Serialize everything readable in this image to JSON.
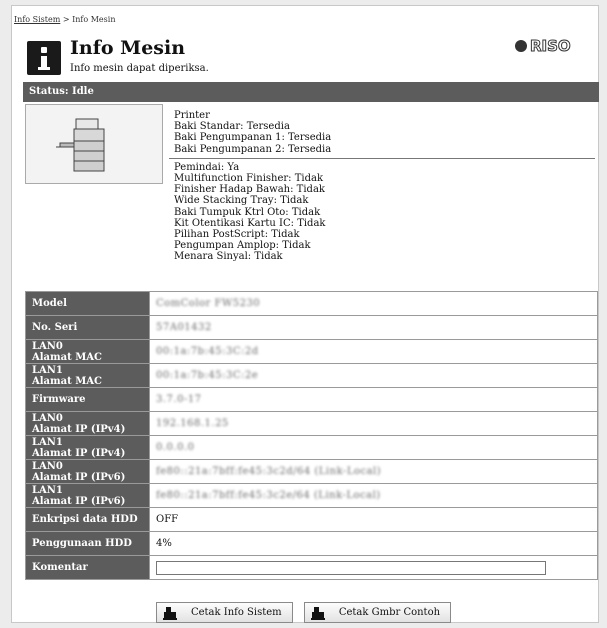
{
  "breadcrumb": {
    "link": "Info Sistem",
    "separator": ">",
    "current": "Info Mesin"
  },
  "header": {
    "title": "Info Mesin",
    "subtitle": "Info mesin dapat diperiksa.",
    "logo_text": "RISO"
  },
  "status": {
    "label": "Status: Idle"
  },
  "specs": {
    "group1": [
      "Printer",
      "Baki Standar: Tersedia",
      "Baki Pengumpanan 1: Tersedia",
      "Baki Pengumpanan 2: Tersedia"
    ],
    "group2": [
      "Pemindai: Ya",
      "Multifunction Finisher: Tidak",
      "Finisher Hadap Bawah: Tidak",
      "Wide Stacking Tray: Tidak",
      "Baki Tumpuk Ktrl Oto: Tidak",
      "Kit Otentikasi Kartu IC: Tidak",
      "Pilihan PostScript: Tidak",
      "Pengumpan Amplop: Tidak",
      "Menara Sinyal: Tidak"
    ]
  },
  "table": [
    {
      "label": [
        "Model"
      ],
      "value": "ComColor FW5230",
      "blurred": true
    },
    {
      "label": [
        "No. Seri"
      ],
      "value": "57A01432",
      "blurred": true
    },
    {
      "label": [
        "LAN0",
        "Alamat MAC"
      ],
      "value": "00:1a:7b:45:3C:2d",
      "blurred": true
    },
    {
      "label": [
        "LAN1",
        "Alamat MAC"
      ],
      "value": "00:1a:7b:45:3C:2e",
      "blurred": true
    },
    {
      "label": [
        "Firmware"
      ],
      "value": "3.7.0-17",
      "blurred": true
    },
    {
      "label": [
        "LAN0",
        "Alamat IP (IPv4)"
      ],
      "value": "192.168.1.25",
      "blurred": true
    },
    {
      "label": [
        "LAN1",
        "Alamat IP (IPv4)"
      ],
      "value": "0.0.0.0",
      "blurred": true
    },
    {
      "label": [
        "LAN0",
        "Alamat IP (IPv6)"
      ],
      "value": "fe80::21a:7bff:fe45:3c2d/64 (Link-Local)",
      "blurred": true
    },
    {
      "label": [
        "LAN1",
        "Alamat IP (IPv6)"
      ],
      "value": "fe80::21a:7bff:fe45:3c2e/64 (Link-Local)",
      "blurred": true
    },
    {
      "label": [
        "Enkripsi data HDD"
      ],
      "value": "OFF",
      "blurred": false
    },
    {
      "label": [
        "Penggunaan HDD"
      ],
      "value": "4%",
      "blurred": false
    },
    {
      "label": [
        "Komentar"
      ],
      "value": "",
      "input": true
    }
  ],
  "buttons": {
    "print_info": "Cetak Info Sistem",
    "print_sample": "Cetak Gmbr Contoh"
  }
}
